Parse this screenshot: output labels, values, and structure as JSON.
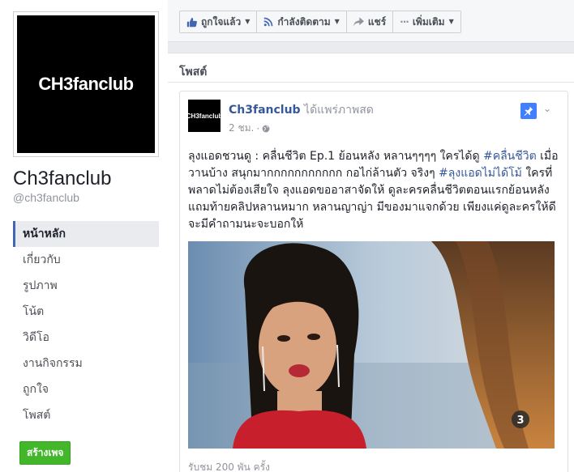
{
  "page": {
    "cover_logo_text": "CH3fanclub",
    "name": "Ch3fanclub",
    "handle": "@ch3fanclub"
  },
  "nav": {
    "items": [
      {
        "label": "หน้าหลัก",
        "active": true
      },
      {
        "label": "เกี่ยวกับ"
      },
      {
        "label": "รูปภาพ"
      },
      {
        "label": "โน้ต"
      },
      {
        "label": "วิดีโอ"
      },
      {
        "label": "งานกิจกรรม"
      },
      {
        "label": "ถูกใจ"
      },
      {
        "label": "โพสต์"
      }
    ],
    "create_page": "สร้างเพจ"
  },
  "actions": {
    "liked": "ถูกใจแล้ว",
    "following": "กำลังติดตาม",
    "share": "แชร์",
    "more": "เพิ่มเติม"
  },
  "posts": {
    "header": "โพสต์",
    "post": {
      "avatar_text": "CH3fanclub",
      "author": "Ch3fanclub",
      "action": "ได้แพร่ภาพสด",
      "time": "2 ชม.",
      "text_1": "ลุงแอดชวนดู : คลื่นชีวิต Ep.1 ย้อนหลัง หลานๆๆๆๆ ใครได้ดู ",
      "hashtag_1": "#คลื่นชีวิต",
      "text_2": " เมื่อวานบ้าง สนุกมากกกกกกกกกกก กอไก่ล้านตัว จริงๆ ",
      "hashtag_2": "#ลุงแอดไม่ได้โม้",
      "text_3": " ใครที่พลาดไม่ต้องเสียใจ ลุงแอดขออาสาจัดให้ ดูละครคลื่นชีวิตตอนแรกย้อนหลัง แถมท้ายคลิปหลานหมาก หลานญาญ่า มีของมาแจกด้วย เพียงแค่ดูละครให้ดี จะมีคำถามนะจะบอกให้",
      "views": "รับชม 200 พัน ครั้ง"
    }
  },
  "colors": {
    "link": "#365899",
    "green_button": "#42b72a",
    "pin": "#4080ff"
  }
}
